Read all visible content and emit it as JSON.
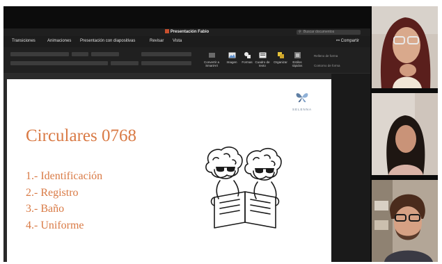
{
  "window": {
    "title": "Presentación Fabio",
    "search_placeholder": "Buscar documentos"
  },
  "menu": {
    "items": [
      "Transiciones",
      "Animaciones",
      "Presentación con diapositivas",
      "Revisar",
      "Vista"
    ],
    "share_label": "Compartir"
  },
  "ribbon": {
    "buttons": [
      {
        "label": "Imagen",
        "icon": "image-icon"
      },
      {
        "label": "Formas",
        "icon": "shapes-icon"
      },
      {
        "label": "Cuadro de texto",
        "icon": "text-box-icon"
      },
      {
        "label": "Organizar",
        "icon": "arrange-icon"
      },
      {
        "label": "Estilos rápidos",
        "icon": "quick-styles-icon"
      }
    ],
    "shape_fill_label": "Relleno de forma",
    "shape_outline_label": "Contorno de forma",
    "convert_label": "Convertir a SmartArt"
  },
  "slide": {
    "brand": "SELENNA",
    "title": "Circulares 0768",
    "items": [
      "1.- Identificación",
      "2.- Registro",
      "3.- Baño",
      "4.- Uniforme"
    ],
    "accent_color": "#d97a45"
  },
  "participants": [
    {
      "description": "participant-woman-glasses",
      "icon": "video-tile"
    },
    {
      "description": "participant-woman",
      "icon": "video-tile"
    },
    {
      "description": "participant-man-glasses",
      "icon": "video-tile"
    }
  ]
}
